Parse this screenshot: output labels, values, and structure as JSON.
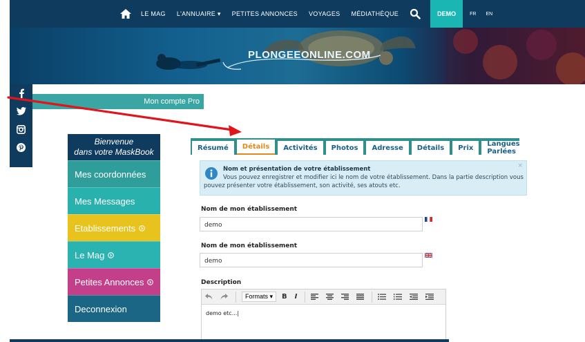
{
  "nav": {
    "items": [
      "LE MAG",
      "L'ANNUAIRE ▾",
      "PETITES ANNONCES",
      "VOYAGES",
      "MÉDIATHÈQUE"
    ],
    "demo": "DEMO",
    "lang_fr": "FR",
    "lang_en": "EN",
    "icons": [
      "home-icon",
      "search-icon"
    ]
  },
  "banner": {
    "brand": "PLONGEEONLINE.COM"
  },
  "social": {
    "icons": [
      "facebook-icon",
      "twitter-icon",
      "instagram-icon",
      "pinterest-icon"
    ]
  },
  "account": {
    "label": "Mon compte Pro"
  },
  "menu": {
    "welcome_line1": "Bienvenue",
    "welcome_line2": "dans votre MaskBook",
    "items": [
      {
        "label": "Mes coordonnées",
        "color": "#2f9e9b"
      },
      {
        "label": "Mes Messages",
        "color": "#29b1ae"
      },
      {
        "label": "Etablissements",
        "color": "#e8c21d"
      },
      {
        "label": "Le Mag",
        "color": "#2ab3b0"
      },
      {
        "label": "Petites Annonces",
        "color": "#c33f8a"
      },
      {
        "label": "Deconnexion",
        "color": "#1b6585"
      }
    ]
  },
  "tabs": [
    "Résumé",
    "Détails",
    "Activités",
    "Photos",
    "Adresse",
    "Détails",
    "Prix",
    "Langues Parlées"
  ],
  "active_tab": "Détails",
  "info": {
    "title": "Nom et présentation de votre établissement",
    "line1": "Vous pouvez enregistrer et modifier ici le nom de votre établissement. Dans la partie description vous",
    "line2": "pouvez présenter votre établissement, son activité, ses atouts etc.",
    "close": "×"
  },
  "form": {
    "name_fr_label": "Nom de mon établissement",
    "name_fr_value": "demo",
    "name_en_label": "Nom de mon établissement",
    "name_en_value": "demo",
    "description_label": "Description",
    "description_value": "demo etc...|"
  },
  "editor": {
    "formats": "Formats ▾",
    "bold": "B",
    "italic": "I"
  },
  "colors": {
    "nav": "#0e3b5e",
    "accent": "#19b6b4",
    "arrow": "#e0141a",
    "active_tab": "#e08a1b"
  }
}
